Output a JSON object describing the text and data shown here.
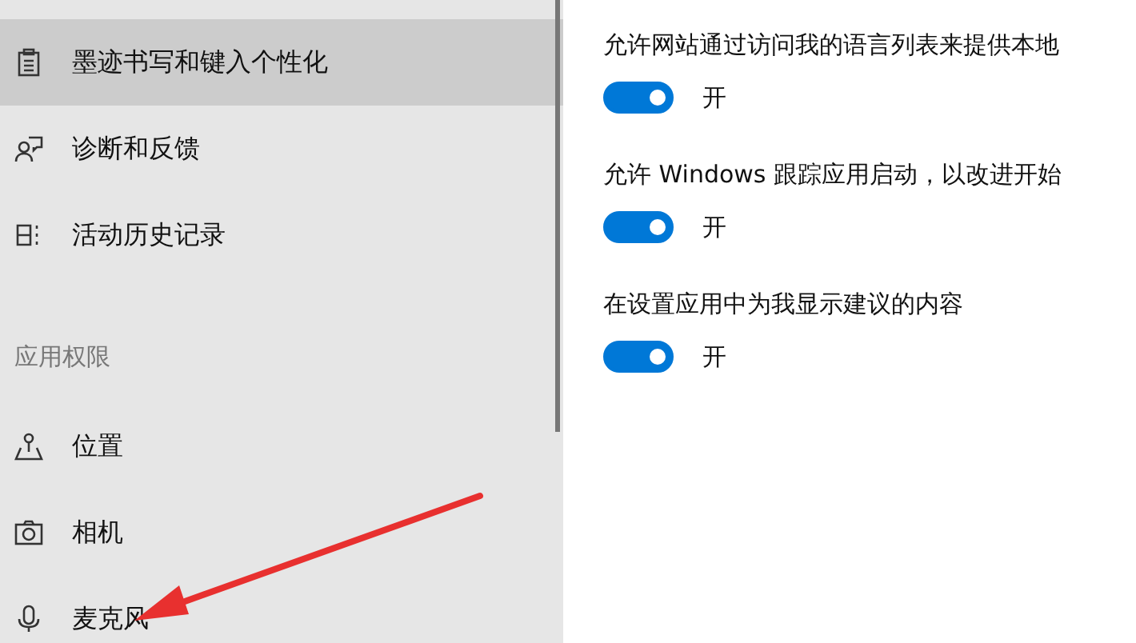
{
  "sidebar": {
    "items": [
      {
        "label": "墨迹书写和键入个性化",
        "kind": "ink",
        "selected": true
      },
      {
        "label": "诊断和反馈",
        "kind": "feedback",
        "selected": false
      },
      {
        "label": "活动历史记录",
        "kind": "history",
        "selected": false
      }
    ],
    "section_header": "应用权限",
    "permission_items": [
      {
        "label": "位置",
        "kind": "location",
        "selected": false
      },
      {
        "label": "相机",
        "kind": "camera",
        "selected": false
      },
      {
        "label": "麦克风",
        "kind": "microphone",
        "selected": false
      }
    ]
  },
  "settings": [
    {
      "title": "允许网站通过访问我的语言列表来提供本地",
      "on": true,
      "state_label": "开"
    },
    {
      "title": "允许 Windows 跟踪应用启动，以改进开始",
      "on": true,
      "state_label": "开"
    },
    {
      "title": "在设置应用中为我显示建议的内容",
      "on": true,
      "state_label": "开"
    }
  ]
}
